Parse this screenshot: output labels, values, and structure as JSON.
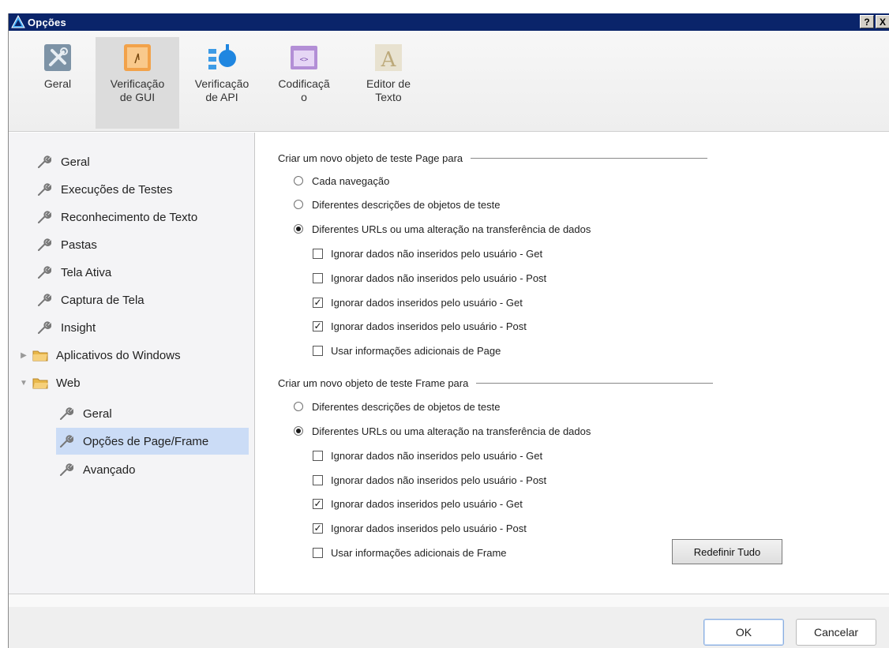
{
  "window": {
    "title": "Opções",
    "help_label": "?",
    "close_label": "X"
  },
  "toolbar": {
    "items": [
      {
        "label": "Geral",
        "icon": "tools-icon"
      },
      {
        "label": "Verificação\nde GUI",
        "icon": "gui-check-icon",
        "active": true
      },
      {
        "label": "Verificação\nde API",
        "icon": "api-check-icon"
      },
      {
        "label": "Codificaçã\no",
        "icon": "coding-icon"
      },
      {
        "label": "Editor de\nTexto",
        "icon": "text-editor-icon"
      }
    ]
  },
  "tree": {
    "items": [
      {
        "label": "Geral"
      },
      {
        "label": "Execuções de Testes"
      },
      {
        "label": "Reconhecimento de Texto"
      },
      {
        "label": "Pastas"
      },
      {
        "label": "Tela Ativa"
      },
      {
        "label": "Captura de Tela"
      },
      {
        "label": "Insight"
      },
      {
        "label": "Aplicativos do Windows"
      },
      {
        "label": "Web"
      },
      {
        "label": "Geral"
      },
      {
        "label": "Opções de Page/Frame",
        "selected": true
      },
      {
        "label": "Avançado"
      }
    ]
  },
  "page_group": {
    "title": "Criar um novo objeto de teste Page para",
    "options": [
      {
        "label": "Cada navegação",
        "type": "radio",
        "checked": false
      },
      {
        "label": "Diferentes descrições de objetos de teste",
        "type": "radio",
        "checked": false
      },
      {
        "label": "Diferentes URLs ou uma alteração na transferência de dados",
        "type": "radio",
        "checked": true
      },
      {
        "label": "Ignorar dados não inseridos pelo usuário - Get",
        "type": "checkbox",
        "checked": false
      },
      {
        "label": "Ignorar dados não inseridos pelo usuário - Post",
        "type": "checkbox",
        "checked": false
      },
      {
        "label": "Ignorar dados inseridos pelo usuário - Get",
        "type": "checkbox",
        "checked": true
      },
      {
        "label": "Ignorar dados inseridos pelo usuário - Post",
        "type": "checkbox",
        "checked": true
      },
      {
        "label": "Usar informações adicionais de Page",
        "type": "checkbox",
        "checked": false
      }
    ]
  },
  "frame_group": {
    "title": "Criar um novo objeto de teste Frame para",
    "options": [
      {
        "label": "Diferentes descrições de objetos de teste",
        "type": "radio",
        "checked": false
      },
      {
        "label": "Diferentes URLs ou uma alteração na transferência de dados",
        "type": "radio",
        "checked": true
      },
      {
        "label": "Ignorar dados não inseridos pelo usuário - Get",
        "type": "checkbox",
        "checked": false
      },
      {
        "label": "Ignorar dados não inseridos pelo usuário - Post",
        "type": "checkbox",
        "checked": false
      },
      {
        "label": "Ignorar dados inseridos pelo usuário - Get",
        "type": "checkbox",
        "checked": true
      },
      {
        "label": "Ignorar dados inseridos pelo usuário - Post",
        "type": "checkbox",
        "checked": true
      },
      {
        "label": "Usar informações adicionais de Frame",
        "type": "checkbox",
        "checked": false
      }
    ]
  },
  "buttons": {
    "reset": "Redefinir Tudo",
    "ok": "OK",
    "cancel": "Cancelar"
  },
  "colors": {
    "titlebar": "#0a246a",
    "selection": "#cbdcf6",
    "panel": "#f4f4f6"
  }
}
